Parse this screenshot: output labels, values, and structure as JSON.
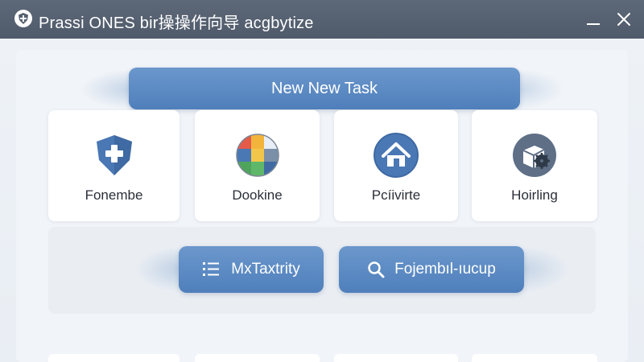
{
  "window": {
    "title": "Prassi ONES bir操操作向导 acgbytize",
    "icons": {
      "app": "shield-cross-icon",
      "minimize": "minimize-icon",
      "close": "close-icon"
    }
  },
  "primary_action": {
    "label": "New New Task"
  },
  "tiles": [
    {
      "label": "Fonembe",
      "icon": "shield-plus-icon"
    },
    {
      "label": "Dookine",
      "icon": "color-grid-icon"
    },
    {
      "label": "Pcíivirte",
      "icon": "home-icon"
    },
    {
      "label": "Hoirling",
      "icon": "box-gear-icon"
    }
  ],
  "actions": [
    {
      "label": "MxTaxtrity",
      "icon": "list-icon"
    },
    {
      "label": "Fojembıl-ıucup",
      "icon": "search-icon"
    }
  ],
  "colors": {
    "titlebar": "#55606f",
    "accent": "#5a88c2",
    "icon_blue": "#4a78b4"
  }
}
